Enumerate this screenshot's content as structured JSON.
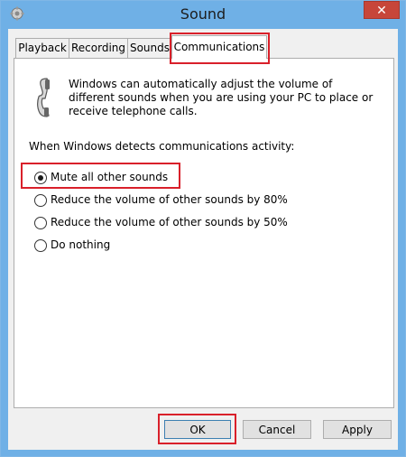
{
  "window": {
    "title": "Sound",
    "close_glyph": "✕",
    "title_icon": "speaker-gear-icon"
  },
  "tabs": [
    {
      "label": "Playback",
      "active": false
    },
    {
      "label": "Recording",
      "active": false
    },
    {
      "label": "Sounds",
      "active": false
    },
    {
      "label": "Communications",
      "active": true
    }
  ],
  "panel": {
    "icon": "telephone-handset-icon",
    "description": "Windows can automatically adjust the volume of different sounds when you are using your PC to place or receive telephone calls.",
    "detects_label": "When Windows detects communications activity:",
    "options": [
      {
        "label": "Mute all other sounds",
        "selected": true
      },
      {
        "label": "Reduce the volume of other sounds by 80%",
        "selected": false
      },
      {
        "label": "Reduce the volume of other sounds by 50%",
        "selected": false
      },
      {
        "label": "Do nothing",
        "selected": false
      }
    ]
  },
  "buttons": {
    "ok": "OK",
    "cancel": "Cancel",
    "apply": "Apply"
  },
  "colors": {
    "titlebar": "#6fb0e6",
    "close": "#c7463a",
    "highlight": "#d9202a"
  }
}
